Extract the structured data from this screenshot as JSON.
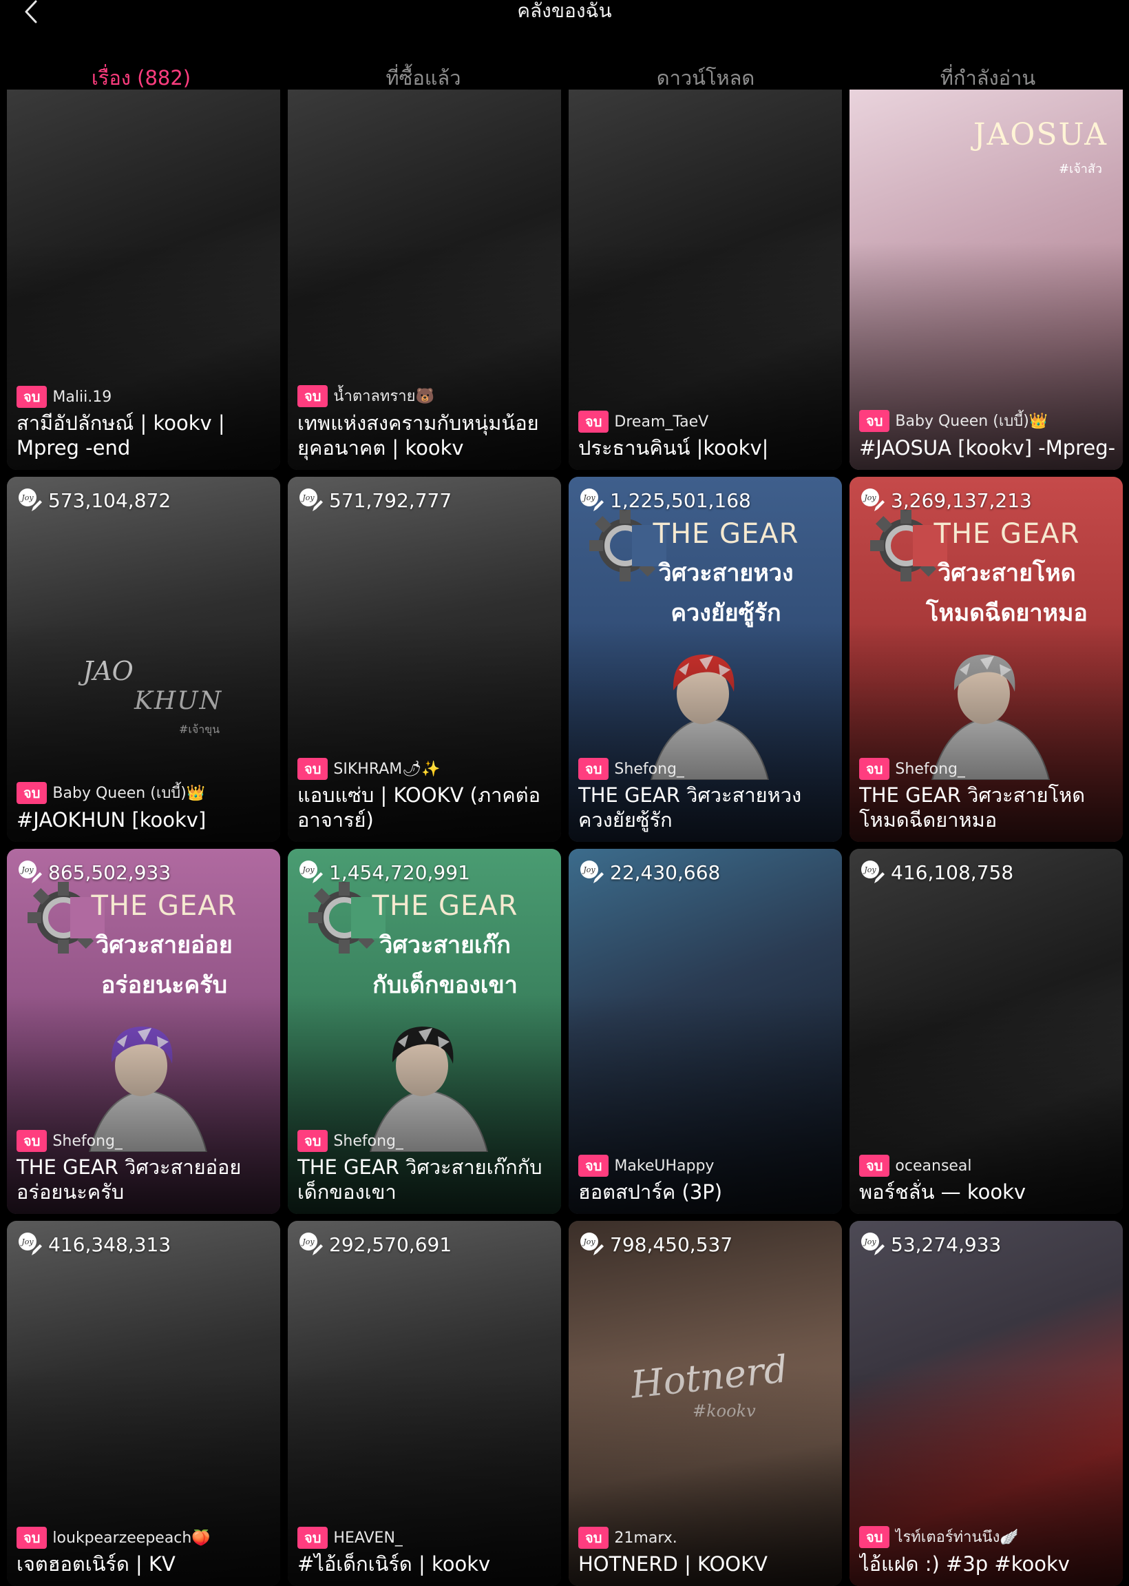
{
  "header": {
    "title": "คลังของฉัน"
  },
  "tabs": [
    {
      "label": "เรื่อง (882)",
      "active": true
    },
    {
      "label": "ที่ซื้อแล้ว",
      "active": false
    },
    {
      "label": "ดาวน์โหลด",
      "active": false
    },
    {
      "label": "ที่กำลังอ่าน",
      "active": false
    }
  ],
  "colors": {
    "accent": "#ff3d7f",
    "background": "#000000"
  },
  "stories": [
    {
      "views": "",
      "badge": "จบ",
      "author": "Malii.19",
      "title": "สามีอัปลักษณ์ | kookv | Mpreg -end",
      "cover_style": "dark-photo"
    },
    {
      "views": "",
      "badge": "จบ",
      "author": "น้ำตาลทราย🐻",
      "title": "เทพแห่งสงครามกับหนุ่มน้อยยุคอนาคต | kookv",
      "cover_style": "dark-photo"
    },
    {
      "views": "",
      "badge": "จบ",
      "author": "Dream_TaeV",
      "title": "ประธานคินน์ |kookv|",
      "cover_style": "dark-photo"
    },
    {
      "views": "",
      "badge": "จบ",
      "author": "Baby Queen (เบบี้)👑",
      "title": "#JAOSUA [kookv] -Mpreg-",
      "cover_style": "pink-photo",
      "cover_text": "JAOSUA",
      "cover_hashtag": "#เจ้าสัว"
    },
    {
      "views": "573,104,872",
      "badge": "จบ",
      "author": "Baby Queen (เบบี้)👑",
      "title": "#JAOKHUN [kookv]",
      "cover_style": "bw-photo",
      "cover_text_1": "JAO",
      "cover_text_2": "KHUN",
      "cover_hashtag": "#เจ้าขุน"
    },
    {
      "views": "571,792,777",
      "badge": "จบ",
      "author": "SIKHRAM🌶✨",
      "title": "แอบแซ่บ | KOOKV (ภาคต่อ อาจารย์)",
      "cover_style": "bw-photo"
    },
    {
      "views": "1,225,501,168",
      "badge": "จบ",
      "author": "Shefong_",
      "title": "THE GEAR วิศวะสายหวงควงยัยซู้รัก",
      "cover_style": "gear-blue",
      "gear_1": "THE GEAR",
      "gear_2": "วิศวะสายหวง",
      "gear_3": "ควงยัยซู้รัก"
    },
    {
      "views": "3,269,137,213",
      "badge": "จบ",
      "author": "Shefong_",
      "title": "THE GEAR วิศวะสายโหดโหมดฉีดยาหมอ",
      "cover_style": "gear-red",
      "gear_1": "THE GEAR",
      "gear_2": "วิศวะสายโหด",
      "gear_3": "โหมดฉีดยาหมอ"
    },
    {
      "views": "865,502,933",
      "badge": "จบ",
      "author": "Shefong_",
      "title": "THE GEAR วิศวะสายอ่อยอร่อยนะครับ",
      "cover_style": "gear-purple",
      "gear_1": "THE GEAR",
      "gear_2": "วิศวะสายอ่อย",
      "gear_3": "อร่อยนะครับ"
    },
    {
      "views": "1,454,720,991",
      "badge": "จบ",
      "author": "Shefong_",
      "title": "THE GEAR วิศวะสายเก๊กกับเด็กของเขา",
      "cover_style": "gear-green",
      "gear_1": "THE GEAR",
      "gear_2": "วิศวะสายเก๊ก",
      "gear_3": "กับเด็กของเขา"
    },
    {
      "views": "22,430,668",
      "badge": "จบ",
      "author": "MakeUHappy",
      "title": "ฮอตสปาร์ค (3P)",
      "cover_style": "blue-photo"
    },
    {
      "views": "416,108,758",
      "badge": "จบ",
      "author": "oceanseal",
      "title": "พอร์ชลั่น — kookv",
      "cover_style": "dark-photo"
    },
    {
      "views": "416,348,313",
      "badge": "จบ",
      "author": "loukpearzeepeach🍑",
      "title": "เจตฮอตเนิร์ด | KV",
      "cover_style": "bw-photo"
    },
    {
      "views": "292,570,691",
      "badge": "จบ",
      "author": "HEAVEN_",
      "title": "#ไอ้เด็กเนิร์ด | kookv",
      "cover_style": "bw-photo"
    },
    {
      "views": "798,450,537",
      "badge": "จบ",
      "author": "21marx.",
      "title": "HOTNERD | KOOKV",
      "cover_style": "skin-photo",
      "cover_text": "Hotnerd",
      "cover_hashtag": "#kookv"
    },
    {
      "views": "53,274,933",
      "badge": "จบ",
      "author": "ไรท์เตอร์ท่านนึง🪽",
      "title": "ไอ้แฝด :) #3p #kookv",
      "cover_style": "red-photo"
    }
  ]
}
